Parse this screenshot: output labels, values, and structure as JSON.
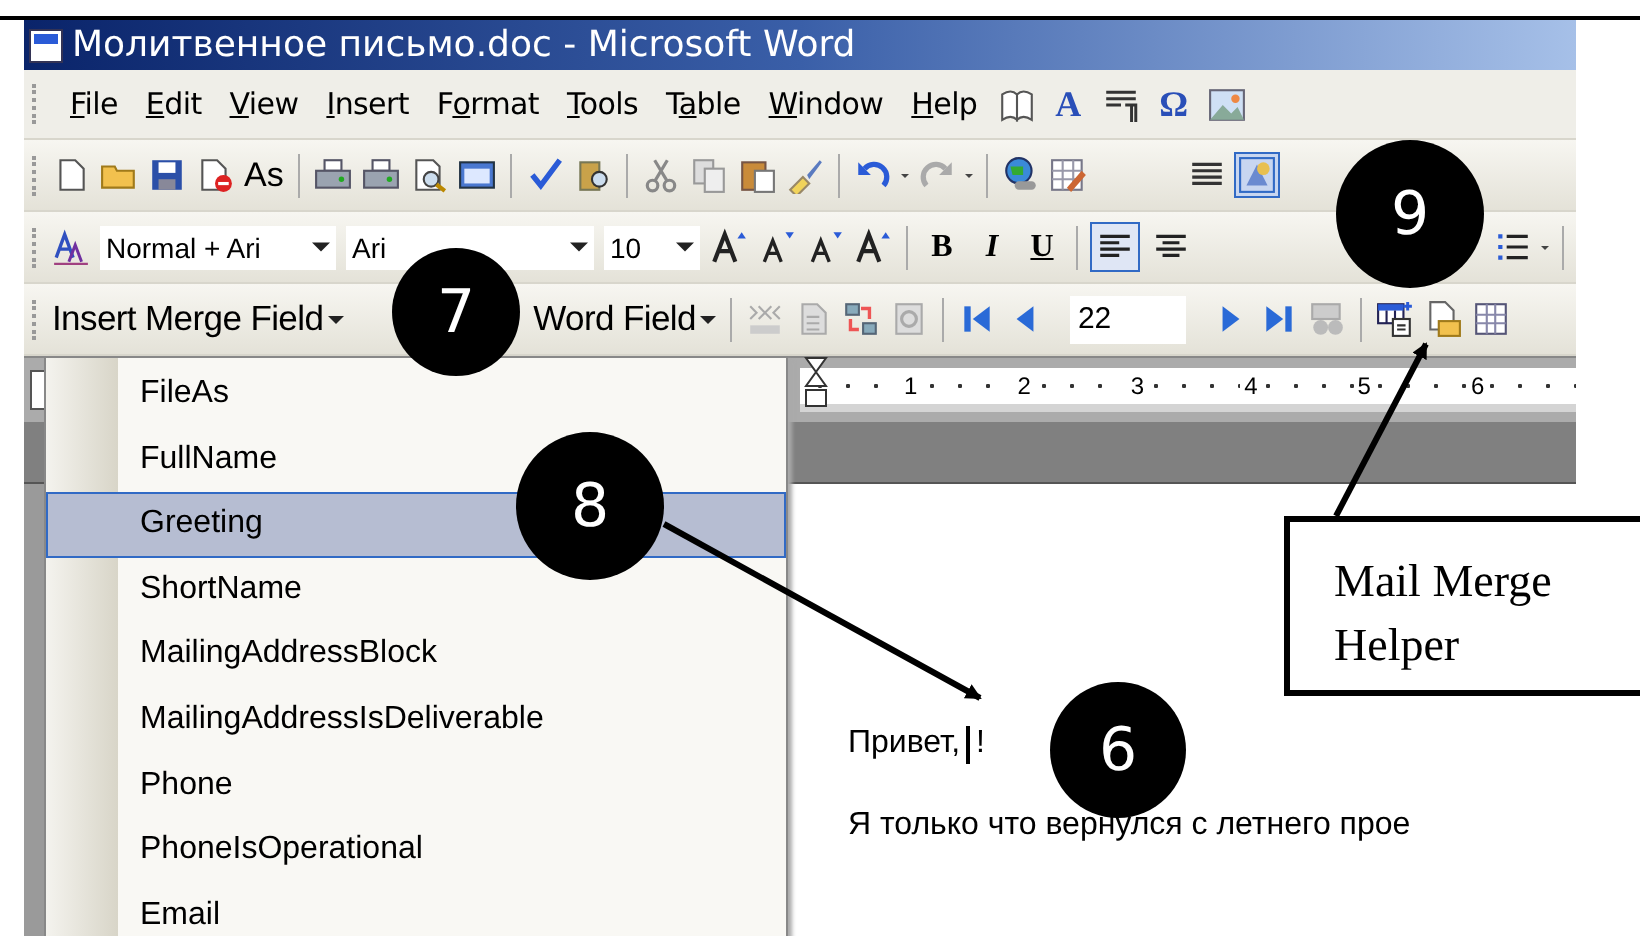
{
  "window": {
    "title": "Молитвенное письмо.doc - Microsoft Word"
  },
  "menu_bar": {
    "items": [
      {
        "key": "F",
        "post": "ile"
      },
      {
        "key": "E",
        "post": "dit"
      },
      {
        "key": "V",
        "post": "iew"
      },
      {
        "key": "I",
        "post": "nsert"
      },
      {
        "pre": "F",
        "key": "o",
        "post": "rmat"
      },
      {
        "key": "T",
        "post": "ools"
      },
      {
        "pre": "T",
        "key": "a",
        "post": "ble"
      },
      {
        "key": "W",
        "post": "indow"
      },
      {
        "key": "H",
        "post": "elp"
      }
    ],
    "extras": [
      {
        "kind": "book"
      },
      {
        "kind": "glyph",
        "text": "A"
      },
      {
        "kind": "paragraph"
      },
      {
        "kind": "glyph",
        "text": "Ω"
      },
      {
        "kind": "image"
      }
    ]
  },
  "standard_toolbar": {
    "as_button": "As"
  },
  "formatting_toolbar": {
    "style": "Normal + Ari",
    "font": "Ari",
    "size": "10",
    "buttons": [
      {
        "text": "B"
      },
      {
        "text": "I"
      },
      {
        "text": "U"
      }
    ],
    "alignment": [
      {
        "selected": true
      },
      {
        "selected": false
      }
    ]
  },
  "mail_merge_toolbar": {
    "insert_merge_field": "Insert Merge Field",
    "word_field": "Word Field",
    "record": "22"
  },
  "ruler": {
    "numbers": [
      "1",
      "2",
      "3",
      "4",
      "5",
      "6"
    ]
  },
  "merge_menu": {
    "items": [
      {
        "label": "FileAs",
        "selected": false
      },
      {
        "label": "FullName",
        "selected": false
      },
      {
        "label": "Greeting",
        "selected": true
      },
      {
        "label": "ShortName",
        "selected": false
      },
      {
        "label": "MailingAddressBlock",
        "selected": false
      },
      {
        "label": "MailingAddressIsDeliverable",
        "selected": false
      },
      {
        "label": "Phone",
        "selected": false
      },
      {
        "label": "PhoneIsOperational",
        "selected": false
      },
      {
        "label": "Email",
        "selected": false
      }
    ]
  },
  "document": {
    "greeting_before": "Привет,",
    "greeting_after": "!",
    "cursor": true,
    "paragraph": "Я только что вернулся с летнего прое"
  },
  "annotations": {
    "markers": [
      "7",
      "8",
      "9",
      "6"
    ],
    "callout": "Mail Merge Helper"
  }
}
